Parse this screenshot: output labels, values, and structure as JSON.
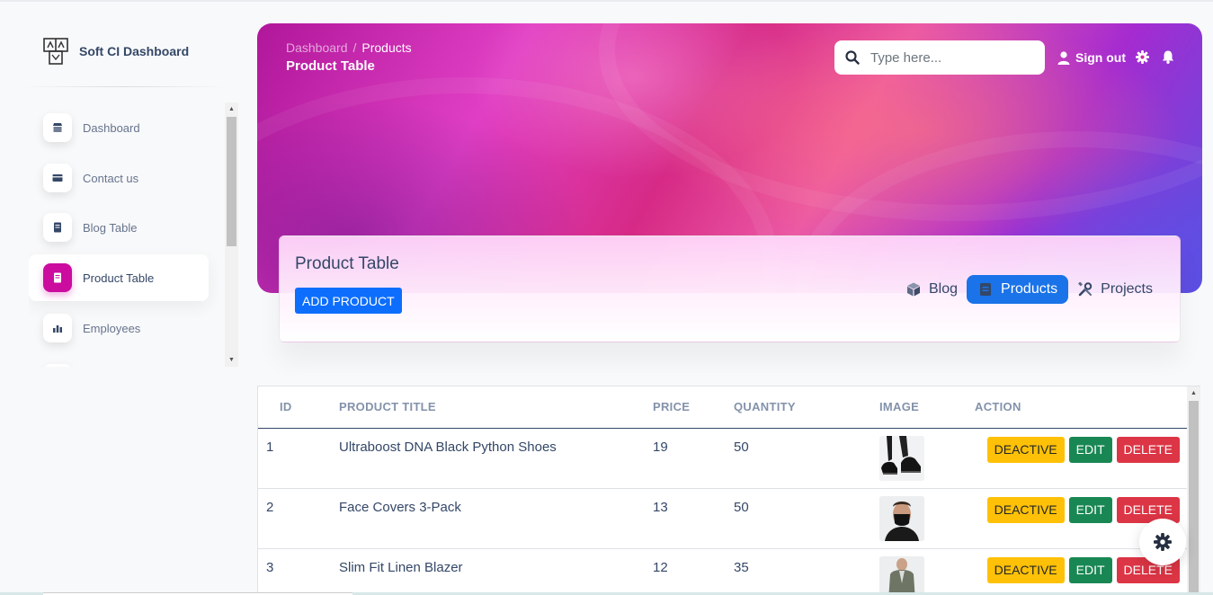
{
  "app": {
    "brand": "Soft CI Dashboard"
  },
  "sidebar": {
    "items": [
      {
        "label": "Dashboard",
        "icon": "shop-icon"
      },
      {
        "label": "Contact us",
        "icon": "credit-card-icon"
      },
      {
        "label": "Blog Table",
        "icon": "document-icon"
      },
      {
        "label": "Product Table",
        "icon": "document-icon",
        "active": true
      },
      {
        "label": "Employees",
        "icon": "chart-bars-icon"
      }
    ]
  },
  "header": {
    "breadcrumb": [
      "Dashboard",
      "Products"
    ],
    "breadcrumb_separator": "/",
    "title": "Product Table",
    "search": {
      "placeholder": "Type here..."
    },
    "signout_label": "Sign out"
  },
  "card": {
    "title": "Product Table",
    "add_button": "ADD PRODUCT",
    "tabs": [
      {
        "label": "Blog",
        "icon": "cube-icon",
        "active": false
      },
      {
        "label": "Products",
        "icon": "document-icon",
        "active": true
      },
      {
        "label": "Projects",
        "icon": "tools-icon",
        "active": false
      }
    ]
  },
  "table": {
    "columns": [
      "ID",
      "PRODUCT TITLE",
      "PRICE",
      "QUANTITY",
      "IMAGE",
      "ACTION"
    ],
    "rows": [
      {
        "id": "1",
        "title": "Ultraboost DNA Black Python Shoes",
        "price": "19",
        "quantity": "50",
        "image": "shoes-photo"
      },
      {
        "id": "2",
        "title": "Face Covers 3-Pack",
        "price": "13",
        "quantity": "50",
        "image": "face-mask-photo"
      },
      {
        "id": "3",
        "title": "Slim Fit Linen Blazer",
        "price": "12",
        "quantity": "35",
        "image": "blazer-photo"
      }
    ],
    "actions": {
      "deactive": "DEACTIVE",
      "edit": "EDIT",
      "delete": "DELETE"
    }
  },
  "colors": {
    "primary": "#cb0c9f",
    "blue": "#0d6efd",
    "tab_active": "#1a73e8",
    "warning": "#ffc107",
    "success": "#198754",
    "danger": "#dc3545"
  }
}
